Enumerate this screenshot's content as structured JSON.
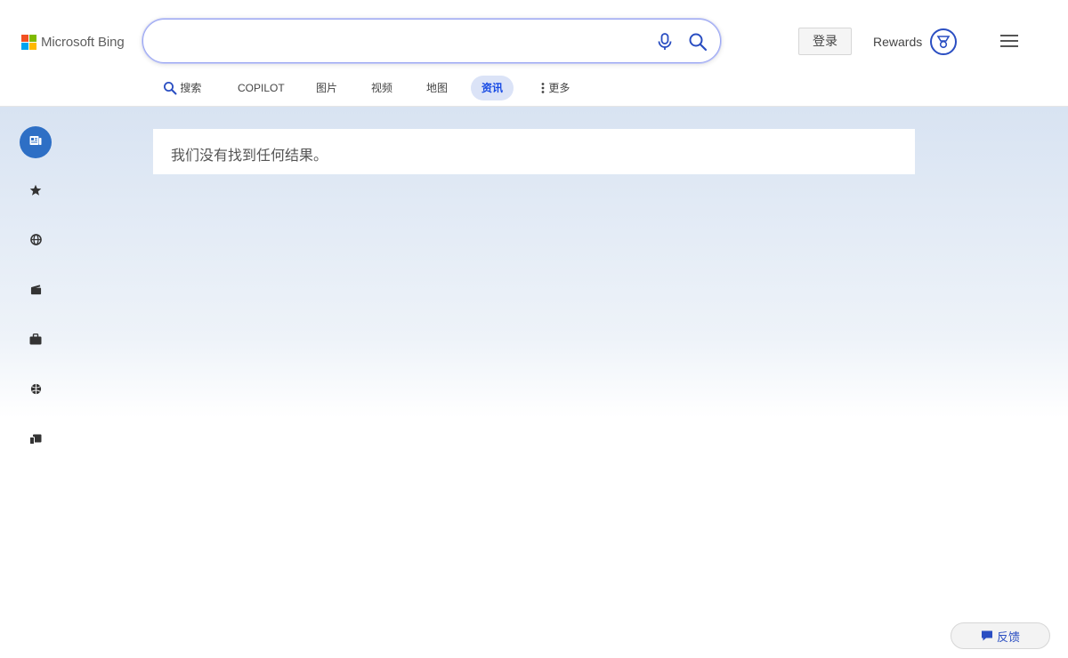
{
  "header": {
    "logo_text": "Microsoft Bing",
    "search": {
      "value": "",
      "placeholder": ""
    },
    "signin_label": "登录",
    "rewards_label": "Rewards"
  },
  "tabs": [
    {
      "label": "搜索",
      "icon": "search-icon"
    },
    {
      "label": "COPILOT"
    },
    {
      "label": "图片"
    },
    {
      "label": "视频"
    },
    {
      "label": "地图"
    },
    {
      "label": "资讯",
      "active": true
    },
    {
      "label": "更多",
      "icon": "more-vertical-icon"
    }
  ],
  "sidebar": {
    "items": [
      {
        "icon": "news-icon",
        "active": true
      },
      {
        "icon": "star-icon"
      },
      {
        "icon": "globe-icon"
      },
      {
        "icon": "clapperboard-icon"
      },
      {
        "icon": "briefcase-icon"
      },
      {
        "icon": "sports-ball-icon"
      },
      {
        "icon": "devices-icon"
      }
    ]
  },
  "main": {
    "no_results_text": "我们没有找到任何结果。"
  },
  "footer": {
    "feedback_label": "反馈"
  },
  "colors": {
    "accent": "#174ae4",
    "active_tab_bg": "#dbe3f7",
    "rail_active": "#2e6fc5",
    "ms_red": "#f25022",
    "ms_green": "#7fba00",
    "ms_blue": "#00a4ef",
    "ms_yellow": "#ffb900"
  }
}
